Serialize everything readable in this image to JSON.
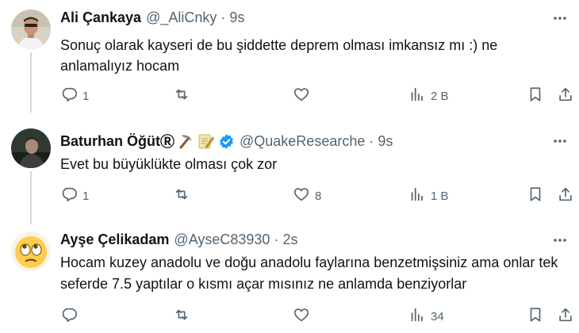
{
  "replies": [
    {
      "name": "Ali Çankaya",
      "handle": "@_AliCnky",
      "separator": "·",
      "time": "9s",
      "text": "Sonuç olarak kayseri de bu şiddette deprem olması imkansız mı :) ne anlamalıyız hocam",
      "reply_count": "1",
      "retweet_count": "",
      "like_count": "",
      "views": "2 B"
    },
    {
      "name": "Baturhan Öğüt",
      "name_suffix": "Ⓡ",
      "handle": "@QuakeResearche",
      "separator": "·",
      "time": "9s",
      "text": "Evet bu büyüklükte olması çok zor",
      "reply_count": "1",
      "retweet_count": "",
      "like_count": "8",
      "views": "1 B"
    },
    {
      "name": "Ayşe Çelikadam",
      "handle": "@AyseC83930",
      "separator": "·",
      "time": "2s",
      "text": "Hocam kuzey anadolu ve doğu anadolu faylarına benzetmişsiniz ama onlar tek seferde 7.5 yaptılar o kısmı açar mısınız ne anlamda benziyorlar",
      "reply_count": "",
      "retweet_count": "",
      "like_count": "",
      "views": "34"
    }
  ],
  "colors": {
    "text": "#0f1419",
    "secondary": "#536471",
    "verified": "#1d9bf0",
    "thread_line": "#cfd9de"
  },
  "icons": [
    "more-icon",
    "reply-icon",
    "retweet-icon",
    "like-icon",
    "views-icon",
    "bookmark-icon",
    "share-icon",
    "verified-icon",
    "pickaxe-emoji",
    "memo-emoji",
    "rolling-eyes-emoji"
  ]
}
